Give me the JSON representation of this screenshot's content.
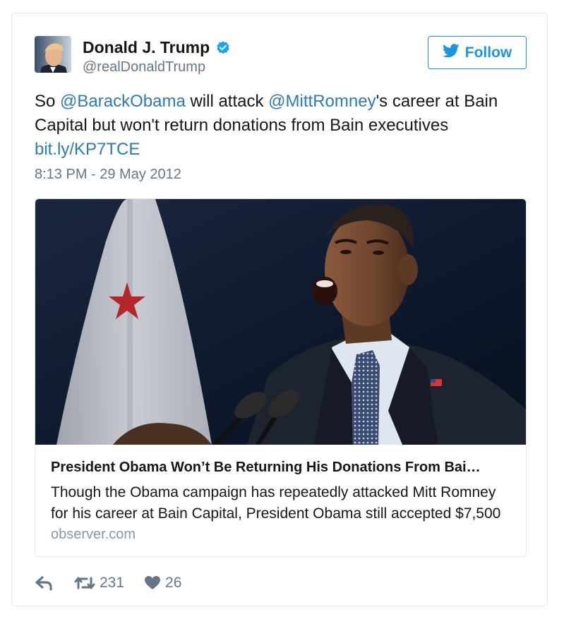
{
  "tweet": {
    "author_name": "Donald J. Trump",
    "author_handle": "@realDonaldTrump",
    "follow_label": "Follow",
    "text_parts": {
      "t1": "So ",
      "mention1": "@BarackObama",
      "t2": " will attack ",
      "mention2": "@MittRomney",
      "t3": "'s career at Bain Capital but won't return donations from Bain executives ",
      "link": "bit.ly/KP7TCE"
    },
    "timestamp": "8:13 PM - 29 May 2012"
  },
  "card": {
    "title": "President Obama Won’t Be Returning His Donations From Bai…",
    "description": "Though the Obama campaign has repeatedly attacked Mitt Romney for his career at Bain Capital, President Obama still accepted $7,500",
    "domain": "observer.com"
  },
  "actions": {
    "retweet_count": "231",
    "like_count": "26"
  },
  "icons": {
    "verified": "verified-badge-icon",
    "follow": "twitter-bird-icon",
    "reply": "reply-icon",
    "retweet": "retweet-icon",
    "like": "heart-icon"
  },
  "colors": {
    "link_blue": "#2b7bb9",
    "follow_blue": "#1b95e0",
    "verified_blue": "#1da1f2",
    "muted_gray": "#657786"
  }
}
